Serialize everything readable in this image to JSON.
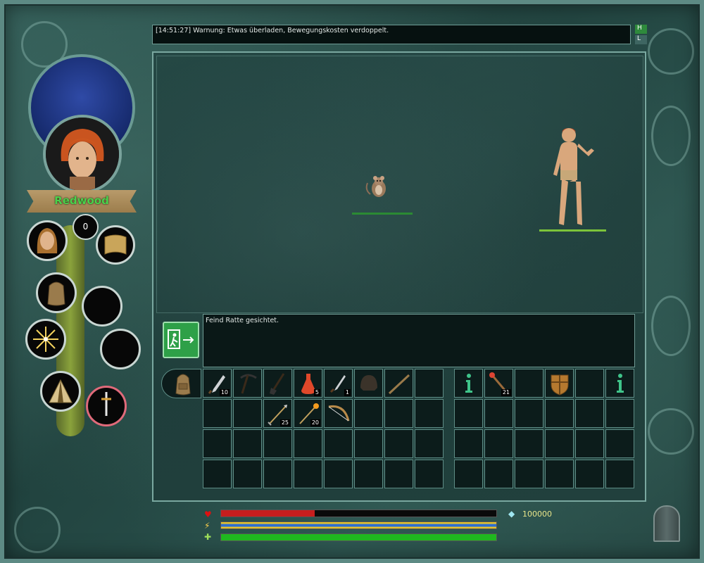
{
  "top_log": {
    "message": "[14:51:27] Warnung: Etwas überladen, Bewegungskosten verdoppelt."
  },
  "log_toggles": {
    "h": "H",
    "l": "L"
  },
  "character": {
    "name": "Redwood",
    "counter": "0"
  },
  "message_log": {
    "message": "Feind Ratte gesichtet."
  },
  "scene": {
    "enemy": {
      "name": "Ratte",
      "icon": "rat-icon"
    },
    "hero": {
      "icon": "hero-figure"
    }
  },
  "inventory": {
    "row1": [
      {
        "icon": "dagger-icon",
        "count": "10"
      },
      {
        "icon": "pickaxe-icon",
        "count": ""
      },
      {
        "icon": "shovel-icon",
        "count": ""
      },
      {
        "icon": "red-potion-icon",
        "count": "5"
      },
      {
        "icon": "throwing-knife-icon",
        "count": "1"
      },
      {
        "icon": "helmet-icon",
        "count": ""
      },
      {
        "icon": "staff-icon",
        "count": ""
      },
      {
        "icon": "",
        "count": ""
      }
    ],
    "row2": [
      {
        "icon": "",
        "count": ""
      },
      {
        "icon": "",
        "count": ""
      },
      {
        "icon": "arrows-icon",
        "count": "25"
      },
      {
        "icon": "fire-arrows-icon",
        "count": "20"
      },
      {
        "icon": "bow-icon",
        "count": ""
      },
      {
        "icon": "",
        "count": ""
      },
      {
        "icon": "",
        "count": ""
      },
      {
        "icon": "",
        "count": ""
      }
    ]
  },
  "equipment": {
    "row1": [
      {
        "icon": "info-icon",
        "count": ""
      },
      {
        "icon": "magic-staff-icon",
        "count": "21"
      },
      {
        "icon": "",
        "count": ""
      },
      {
        "icon": "shield-icon",
        "count": ""
      },
      {
        "icon": "",
        "count": ""
      },
      {
        "icon": "info-icon",
        "count": ""
      }
    ]
  },
  "stats": {
    "health": 0.34,
    "mana": 1.0,
    "stamina": 1.0,
    "colors": {
      "health": "#c61e1e",
      "mana": "#2f6fd0",
      "stamina": "#1fb81f"
    }
  },
  "gold": {
    "amount": "100000",
    "icon": "gem-icon"
  }
}
